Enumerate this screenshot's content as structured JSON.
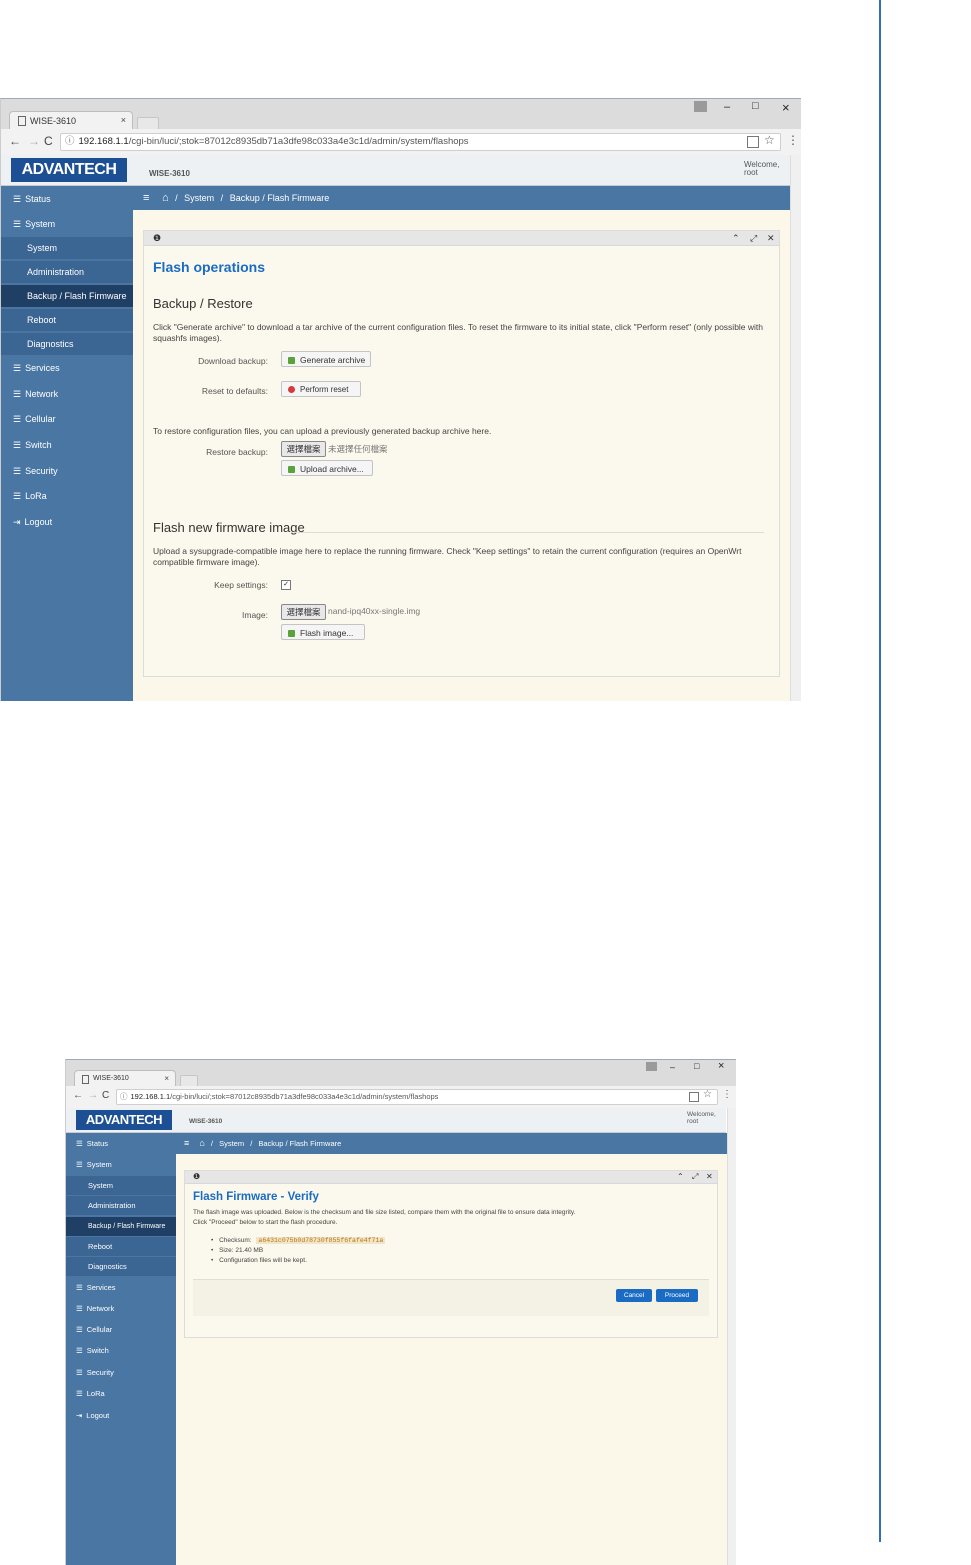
{
  "shot1": {
    "tab_title": "WISE-3610",
    "tab_close": "×",
    "win_min": "–",
    "win_max": "□",
    "win_close": "×",
    "url_host": "192.168.1.1",
    "url_path": "/cgi-bin/luci/;stok=87012c8935db71a3dfe98c033a4e3c1d/admin/system/flashops",
    "logo": "ADVANTECH",
    "product": "WISE-3610",
    "welcome": "Welcome,",
    "user": "root",
    "breadcrumb_system": "System",
    "breadcrumb_sep": "/",
    "breadcrumb_page": "Backup / Flash Firmware",
    "sidebar": [
      {
        "label": "Status"
      },
      {
        "label": "System"
      },
      {
        "label": "System"
      },
      {
        "label": "Administration"
      },
      {
        "label": "Backup / Flash Firmware"
      },
      {
        "label": "Reboot"
      },
      {
        "label": "Diagnostics"
      },
      {
        "label": "Services"
      },
      {
        "label": "Network"
      },
      {
        "label": "Cellular"
      },
      {
        "label": "Switch"
      },
      {
        "label": "Security"
      },
      {
        "label": "LoRa"
      },
      {
        "label": "Logout"
      }
    ],
    "heading": "Flash operations",
    "section1": "Backup / Restore",
    "intro1": "Click \"Generate archive\" to download a tar archive of the current configuration files. To reset the firmware to its initial state, click \"Perform reset\" (only possible with squashfs images).",
    "download_label": "Download backup:",
    "generate_btn": "Generate archive",
    "reset_label": "Reset to defaults:",
    "reset_btn": "Perform reset",
    "restore_intro": "To restore configuration files, you can upload a previously generated backup archive here.",
    "restore_label": "Restore backup:",
    "choose_file": "選擇檔案",
    "no_file": "未選擇任何檔案",
    "upload_btn": "Upload archive...",
    "section2": "Flash new firmware image",
    "intro2": "Upload a sysupgrade-compatible image here to replace the running firmware. Check \"Keep settings\" to retain the current configuration (requires an OpenWrt compatible firmware image).",
    "keep_label": "Keep settings:",
    "image_label": "Image:",
    "choose_file2": "選擇檔案",
    "image_file": "nand-ipq40xx-single.img",
    "flash_btn": "Flash image..."
  },
  "shot2": {
    "tab_title": "WISE-3610",
    "tab_close": "×",
    "url_host": "192.168.1.1",
    "url_path": "/cgi-bin/luci/;stok=87012c8935db71a3dfe98c033a4e3c1d/admin/system/flashops",
    "logo": "ADVANTECH",
    "product": "WISE-3610",
    "welcome": "Welcome,",
    "user": "root",
    "breadcrumb_system": "System",
    "breadcrumb_sep": "/",
    "breadcrumb_page": "Backup / Flash Firmware",
    "sidebar": [
      {
        "label": "Status"
      },
      {
        "label": "System"
      },
      {
        "label": "System"
      },
      {
        "label": "Administration"
      },
      {
        "label": "Backup / Flash Firmware"
      },
      {
        "label": "Reboot"
      },
      {
        "label": "Diagnostics"
      },
      {
        "label": "Services"
      },
      {
        "label": "Network"
      },
      {
        "label": "Cellular"
      },
      {
        "label": "Switch"
      },
      {
        "label": "Security"
      },
      {
        "label": "LoRa"
      },
      {
        "label": "Logout"
      }
    ],
    "heading": "Flash Firmware - Verify",
    "desc1": "The flash image was uploaded. Below is the checksum and file size listed, compare them with the original file to ensure data integrity.",
    "desc2": "Click \"Proceed\" below to start the flash procedure.",
    "checksum_label": "Checksum:",
    "checksum_value": "a6431c075b0d78730f855f6fafe4f71a",
    "size_label": "Size:",
    "size_value": "21.40 MB",
    "config_note": "Configuration files will be kept.",
    "cancel": "Cancel",
    "proceed": "Proceed"
  }
}
